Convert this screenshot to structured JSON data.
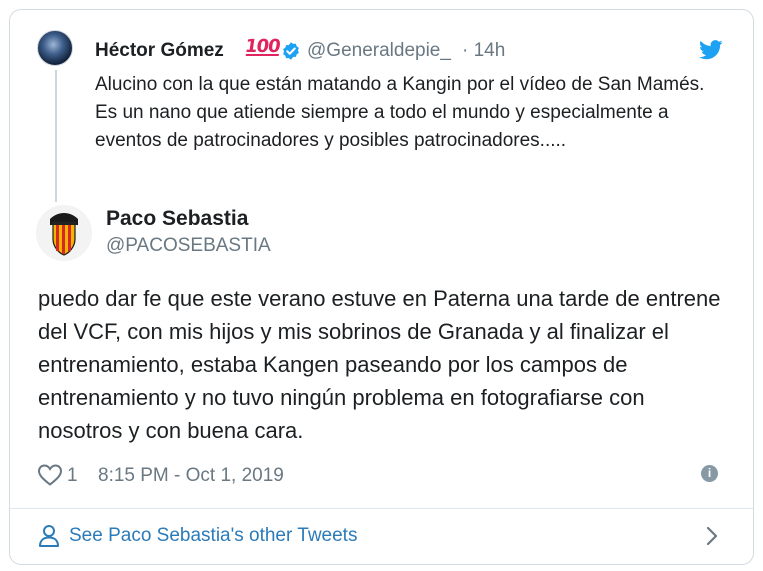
{
  "parent_tweet": {
    "author_name": "Héctor Gómez",
    "emoji": "100",
    "handle": "@Generaldepie_",
    "time": "· 14h",
    "text": "Alucino con la que están matando a Kangin por el vídeo de San Mamés. Es un nano que atiende siempre a todo el mundo y especialmente a eventos de patrocinadores y posibles patrocinadores....."
  },
  "main_tweet": {
    "author_name": "Paco Sebastia",
    "handle": "@PACOSEBASTIA",
    "text": "puedo dar fe que este verano estuve en Paterna una tarde de entrene del VCF, con mis hijos y mis sobrinos de Granada y al finalizar el entrenamiento, estaba Kangen paseando por los campos de entrenamiento y no tuvo ningún problema en fotografiarse con nosotros y con buena cara.",
    "likes": "1",
    "date": "8:15 PM - Oct 1, 2019",
    "info_icon": "i"
  },
  "footer": {
    "see_more_label": "See Paco Sebastia's other Tweets"
  },
  "colors": {
    "verified": "#1da1f2",
    "link": "#2b7bb9",
    "muted": "#697882",
    "text": "#1c2022",
    "emoji_red": "#e0245e"
  },
  "icons": [
    "verified-badge-icon",
    "twitter-bird-icon",
    "heart-icon",
    "info-icon",
    "person-icon",
    "chevron-right-icon"
  ]
}
